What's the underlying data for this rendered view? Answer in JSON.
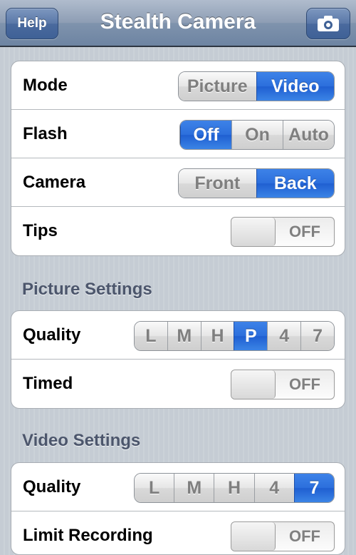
{
  "navbar": {
    "title": "Stealth Camera",
    "help_label": "Help",
    "camera_icon": "camera-icon"
  },
  "groups": {
    "general": {
      "mode": {
        "label": "Mode",
        "options": [
          "Picture",
          "Video"
        ],
        "selected": "Video"
      },
      "flash": {
        "label": "Flash",
        "options": [
          "Off",
          "On",
          "Auto"
        ],
        "selected": "Off"
      },
      "camera": {
        "label": "Camera",
        "options": [
          "Front",
          "Back"
        ],
        "selected": "Back"
      },
      "tips": {
        "label": "Tips",
        "state": "OFF"
      }
    },
    "picture": {
      "header": "Picture Settings",
      "quality": {
        "label": "Quality",
        "options": [
          "L",
          "M",
          "H",
          "P",
          "4",
          "7"
        ],
        "selected": "P"
      },
      "timed": {
        "label": "Timed",
        "state": "OFF"
      }
    },
    "video": {
      "header": "Video Settings",
      "quality": {
        "label": "Quality",
        "options": [
          "L",
          "M",
          "H",
          "4",
          "7"
        ],
        "selected": "7"
      },
      "limit": {
        "label": "Limit Recording",
        "state": "OFF"
      }
    }
  },
  "colors": {
    "accent_blue": "#2c6fdc",
    "navbar": "#7f93ad",
    "background": "#c5ccd4"
  }
}
